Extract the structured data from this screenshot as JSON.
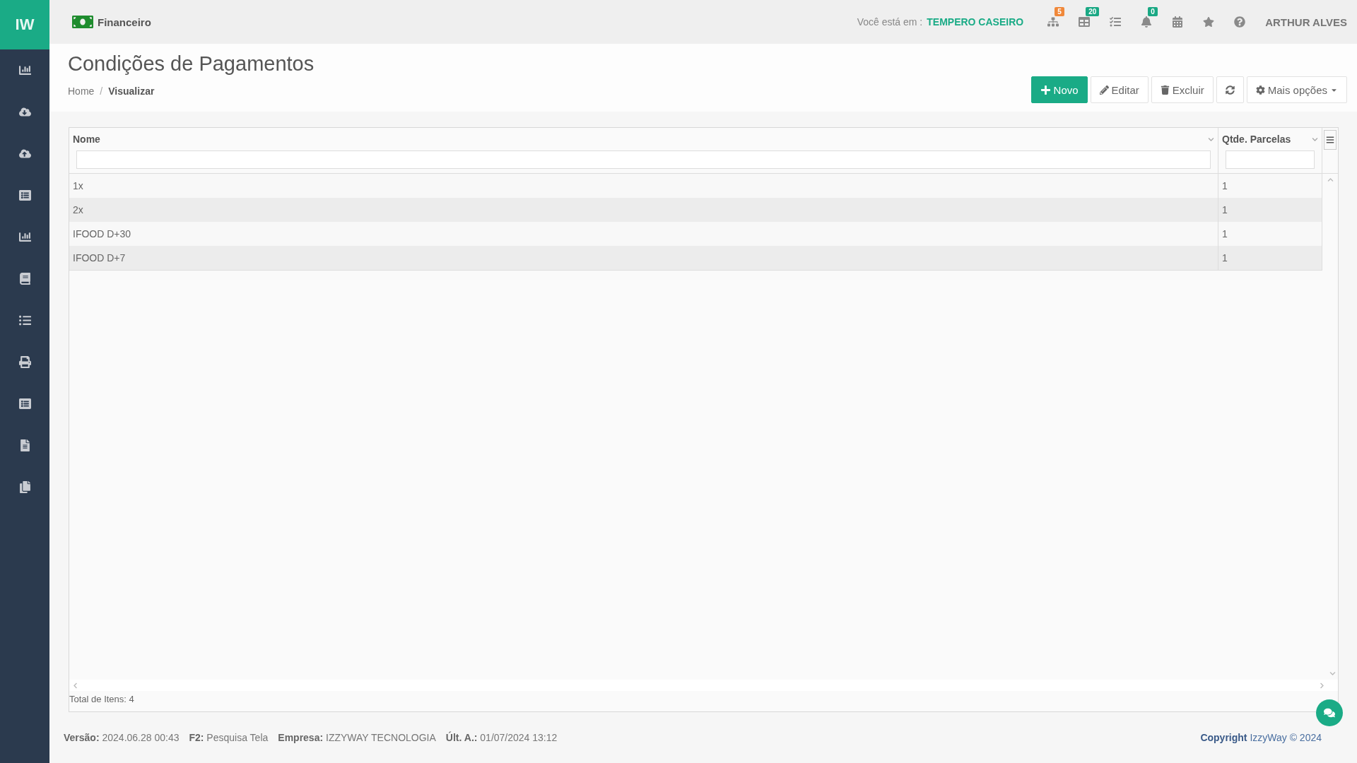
{
  "brand": {
    "logo": "IW",
    "module": "Financeiro"
  },
  "topbar": {
    "location_label": "Você está em :",
    "location": "TEMPERO CASEIRO",
    "badges": [
      {
        "count": "5",
        "color": "#f0883a"
      },
      {
        "count": "20",
        "color": "#1aa884"
      },
      {
        "count": "0",
        "color": "#1aa884"
      }
    ],
    "user": "ARTHUR ALVES"
  },
  "page": {
    "title": "Condições de Pagamentos",
    "separator": "/",
    "breadcrumb": [
      {
        "label": "Home",
        "selected": false
      },
      {
        "label": "Visualizar",
        "selected": true
      }
    ]
  },
  "actions": [
    {
      "kind": "primary",
      "label": "Novo"
    },
    {
      "kind": "edit",
      "label": "Editar"
    },
    {
      "kind": "delete",
      "label": "Excluir"
    },
    {
      "kind": "refresh"
    },
    {
      "kind": "more",
      "label": "Mais opções"
    }
  ],
  "table": {
    "columns": [
      {
        "label": "Nome"
      },
      {
        "label": "Qtde. Parcelas"
      }
    ],
    "rows": [
      [
        "1x",
        "1"
      ],
      [
        "2x",
        "1"
      ],
      [
        "IFOOD D+30",
        "1"
      ],
      [
        "IFOOD D+7",
        "1"
      ]
    ],
    "total": "Total de Itens: 4"
  },
  "footer": {
    "items": [
      "**Versão:** 2024.06.28 00:43",
      "**F2:** Pesquisa Tela",
      "**Empresa:** IZZYWAY TECNOLOGIA",
      "**Últ. A.:** 01/07/2024 13:12"
    ],
    "copyright": "**Copyright** IzzyWay © 2024"
  }
}
